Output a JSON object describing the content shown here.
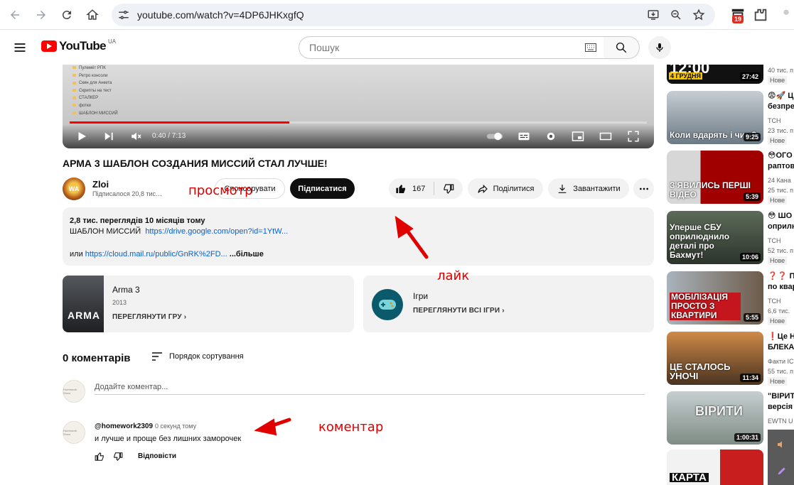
{
  "browser": {
    "url": "youtube.com/watch?v=4DP6JHKxgfQ",
    "extension_badge": "19"
  },
  "header": {
    "logo_text": "YouTube",
    "region": "UA",
    "search_placeholder": "Пошук"
  },
  "player": {
    "folders": [
      "Пулемёт РПК",
      "Ретро консоли",
      "Скин для Анкета",
      "Скрипты на тест",
      "СТАЛКЕР",
      "фотки",
      "ШАБЛОН МИССИЙ"
    ],
    "time": "0:40 / 7:13",
    "progress_fraction": 0.38,
    "accent": "#ff0000"
  },
  "video": {
    "title": "АРМА 3 ШАБЛОН СОЗДАНИЯ МИССИЙ СТАЛ ЛУЧШЕ!",
    "channel": "Zloi",
    "avatar_text": "WA",
    "subscribers": "Підписалося 20,8 тис…",
    "sponsor_label": "Спонсорувати",
    "subscribe_label": "Підписатися",
    "likes": "167",
    "share_label": "Поділитися",
    "download_label": "Завантажити"
  },
  "description": {
    "meta": "2,8 тис. переглядів  10 місяців тому",
    "line1_text": "ШАБЛОН МИССИЙ",
    "line1_link": "https://drive.google.com/open?id=1YtW...",
    "line2_text": "или",
    "line2_link": "https://cloud.mail.ru/public/GnRK%2FD...",
    "more": "...більше"
  },
  "cards": {
    "game": {
      "thumb_text": "ARMA",
      "title": "Arma 3",
      "year": "2013",
      "link": "ПЕРЕГЛЯНУТИ ГРУ"
    },
    "games": {
      "title": "Ігри",
      "link": "ПЕРЕГЛЯНУТИ ВСІ ІГРИ"
    }
  },
  "comments": {
    "count_label": "0 коментарів",
    "sort_label": "Порядок сортування",
    "add_placeholder": "Додайте коментар...",
    "avatar_text": "Homework Show",
    "items": [
      {
        "author": "@homework2309",
        "time": "0 секунд тому",
        "text": "и лучше и проще без лишних заморочек",
        "reply_label": "Відповісти"
      }
    ]
  },
  "annotations": {
    "views": "просмотр",
    "like": "лайк",
    "comment": "коментар",
    "color": "#e00000"
  },
  "sidebar": {
    "top": {
      "thumb_text": "12:00",
      "thumb_date": "4 ГРУДНЯ",
      "duration": "27:42",
      "views": "40 тис. п",
      "badge": "Нове"
    },
    "items": [
      {
        "thumb_text": "Коли вдарять і чим?",
        "duration": "9:25",
        "title": "😨🚀 Ц",
        "title2": "безпре",
        "channel": "ТСН",
        "views": "23 тис. п",
        "badge": "Нове",
        "color": "#7a8a98"
      },
      {
        "thumb_text": "З'ЯВИЛИСЬ ПЕРШІ ВІДЕО",
        "duration": "5:39",
        "title": "😳ОГО",
        "title2": "раптов",
        "channel": "24 Кана",
        "views": "25 тис. п",
        "badge": "Нове",
        "color": "#b00000"
      },
      {
        "thumb_text": "Уперше СБУ оприлюднило деталі про Бахмут!",
        "duration": "10:06",
        "title": "😳 ШО",
        "title2": "оприлю",
        "channel": "ТСН",
        "views": "52 тис. п",
        "badge": "Нове",
        "color": "#3b4a3c"
      },
      {
        "thumb_text": "МОБІЛІЗАЦІЯ ПРОСТО З КВАРТИРИ",
        "duration": "5:55",
        "title": "❓❓ По",
        "title2": "по квар",
        "channel": "ТСН",
        "views": "6,6 тис.",
        "badge": "Нове",
        "color": "#8f1d1d"
      },
      {
        "thumb_text": "ЦЕ СТАЛОСЬ УНОЧІ",
        "duration": "11:34",
        "title": "❗Це НЕ",
        "title2": "БЛЕКА",
        "channel": "Факти IC",
        "views": "55 тис. п",
        "badge": "Нове",
        "color": "#6a4b2f"
      },
      {
        "thumb_text": "ВІРИТИ",
        "duration": "1:00:31",
        "title": "\"ВІРИТ",
        "title2": "версія",
        "channel": "EWTN U",
        "views": "",
        "badge": "",
        "color": "#9aa6a8"
      },
      {
        "thumb_text": "КАРТА",
        "duration": "",
        "title": "",
        "title2": "",
        "channel": "",
        "views": "",
        "badge": "",
        "color": "#c81e1e"
      }
    ]
  }
}
